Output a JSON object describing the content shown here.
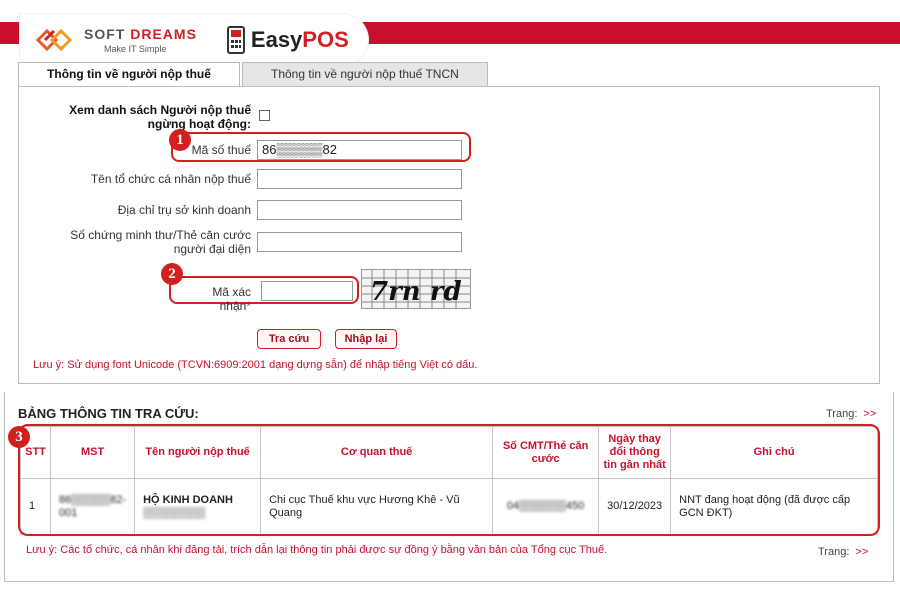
{
  "brand": {
    "softdreams_name_a": "SOFT ",
    "softdreams_name_b": "DREAMS",
    "softdreams_tagline": "Make IT Simple",
    "easypos_a": "Easy",
    "easypos_b": "POS",
    "accent_color": "#d1201f"
  },
  "tabs": [
    {
      "label": "Thông tin về người nộp thuế",
      "active": true
    },
    {
      "label": "Thông tin về người nộp thuế TNCN",
      "active": false
    }
  ],
  "form": {
    "inactive_list_label": "Xem danh sách Người nộp thuế ngừng hoạt động:",
    "tax_code_label": "Mã số thuế",
    "tax_code_value": "86▒▒▒▒▒82",
    "org_name_label": "Tên tổ chức cá nhân nộp thuế",
    "address_label": "Địa chỉ trụ sở kinh doanh",
    "id_label": "Số chứng minh thư/Thẻ căn cước người đại diện",
    "captcha_label": "Mã xác nhận",
    "captcha_required": "*",
    "captcha_text": "7rn rd",
    "search_button": "Tra cứu",
    "reset_button": "Nhập lại",
    "note": "Lưu ý: Sử dụng font Unicode (TCVN:6909:2001 dạng dựng sẵn) để nhập tiếng Việt có dấu."
  },
  "badges": [
    "1",
    "2",
    "3"
  ],
  "results": {
    "title": "BẢNG THÔNG TIN TRA CỨU:",
    "pager_label": "Trang:",
    "pager_arrow": ">>",
    "columns": [
      "STT",
      "MST",
      "Tên người nộp thuế",
      "Cơ quan thuế",
      "Số CMT/Thẻ căn cước",
      "Ngày thay đổi thông tin gần nhất",
      "Ghi chú"
    ],
    "rows": [
      {
        "stt": "1",
        "mst": "86▒▒▒▒▒82-001",
        "name_a": "HỘ KINH DOANH",
        "name_b": "▒▒▒▒▒▒▒▒",
        "agency": "Chi cục Thuế khu vực Hương Khê - Vũ Quang",
        "id": "04▒▒▒▒▒▒450",
        "date": "30/12/2023",
        "note": "NNT đang hoạt động (đã được cấp GCN ĐKT)"
      }
    ],
    "note": "Lưu ý: Các tổ chức, cá nhân khi đăng tải, trích dẫn lại thông tin phải được sự đồng ý bằng văn bản của Tổng cục Thuế."
  }
}
